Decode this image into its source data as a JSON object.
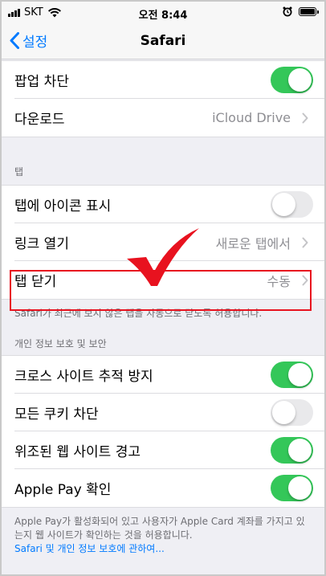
{
  "status": {
    "carrier": "SKT",
    "time": "오전 8:44"
  },
  "nav": {
    "back_label": "설정",
    "title": "Safari"
  },
  "group_top": [
    {
      "label": "팝업 차단",
      "toggle": "on"
    },
    {
      "label": "다운로드",
      "value": "iCloud Drive"
    }
  ],
  "section_tabs": {
    "header": "탭",
    "rows": [
      {
        "label": "탭에 아이콘 표시",
        "toggle": "off"
      },
      {
        "label": "링크 열기",
        "value": "새로운 탭에서"
      },
      {
        "label": "탭 닫기",
        "value": "수동"
      }
    ],
    "footer": "Safari가 최근에 보지 않은 탭을 자동으로 닫도록 허용합니다."
  },
  "section_privacy": {
    "header": "개인 정보 보호 및 보안",
    "rows": [
      {
        "label": "크로스 사이트 추적 방지",
        "toggle": "on"
      },
      {
        "label": "모든 쿠키 차단",
        "toggle": "off"
      },
      {
        "label": "위조된 웹 사이트 경고",
        "toggle": "on"
      },
      {
        "label": "Apple Pay 확인",
        "toggle": "on"
      }
    ],
    "footer": "Apple Pay가 활성화되어 있고 사용자가 Apple Card 계좌를 가지고 있는지 웹 사이트가 확인하는 것을 허용합니다.",
    "footer_link": "Safari 및 개인 정보 보호에 관하여..."
  },
  "colors": {
    "accent": "#007aff",
    "toggle_on": "#34c759",
    "highlight": "#e8121f"
  }
}
